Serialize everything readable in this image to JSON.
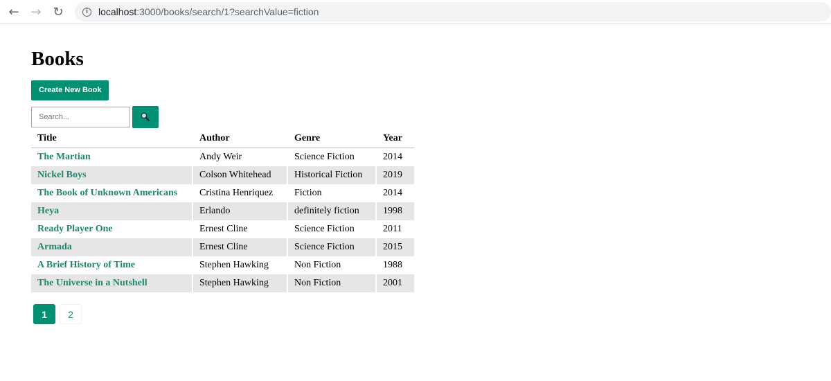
{
  "browser": {
    "url_host": "localhost",
    "url_path": ":3000/books/search/1?searchValue=fiction",
    "back_icon": "arrow-left-icon",
    "forward_icon": "arrow-right-icon",
    "reload_icon": "reload-icon",
    "info_icon": "info-icon"
  },
  "page": {
    "title": "Books",
    "create_button": "Create New Book",
    "search": {
      "placeholder": "Search...",
      "value": "",
      "button_icon": "magnifier-icon"
    }
  },
  "table": {
    "headers": [
      "Title",
      "Author",
      "Genre",
      "Year"
    ],
    "rows": [
      {
        "title": "The Martian",
        "author": "Andy Weir",
        "genre": "Science Fiction",
        "year": "2014"
      },
      {
        "title": "Nickel Boys",
        "author": "Colson Whitehead",
        "genre": "Historical Fiction",
        "year": "2019"
      },
      {
        "title": "The Book of Unknown Americans",
        "author": "Cristina Henriquez",
        "genre": "Fiction",
        "year": "2014"
      },
      {
        "title": "Heya",
        "author": "Erlando",
        "genre": "definitely fiction",
        "year": "1998"
      },
      {
        "title": "Ready Player One",
        "author": "Ernest Cline",
        "genre": "Science Fiction",
        "year": "2011"
      },
      {
        "title": "Armada",
        "author": "Ernest Cline",
        "genre": "Science Fiction",
        "year": "2015"
      },
      {
        "title": "A Brief History of Time",
        "author": "Stephen Hawking",
        "genre": "Non Fiction",
        "year": "1988"
      },
      {
        "title": "The Universe in a Nutshell",
        "author": "Stephen Hawking",
        "genre": "Non Fiction",
        "year": "2001"
      }
    ]
  },
  "pagination": {
    "pages": [
      "1",
      "2"
    ],
    "current": "1"
  },
  "colors": {
    "accent": "#009072",
    "link": "#1a8a6e",
    "row_alt": "#e6e6e6"
  }
}
